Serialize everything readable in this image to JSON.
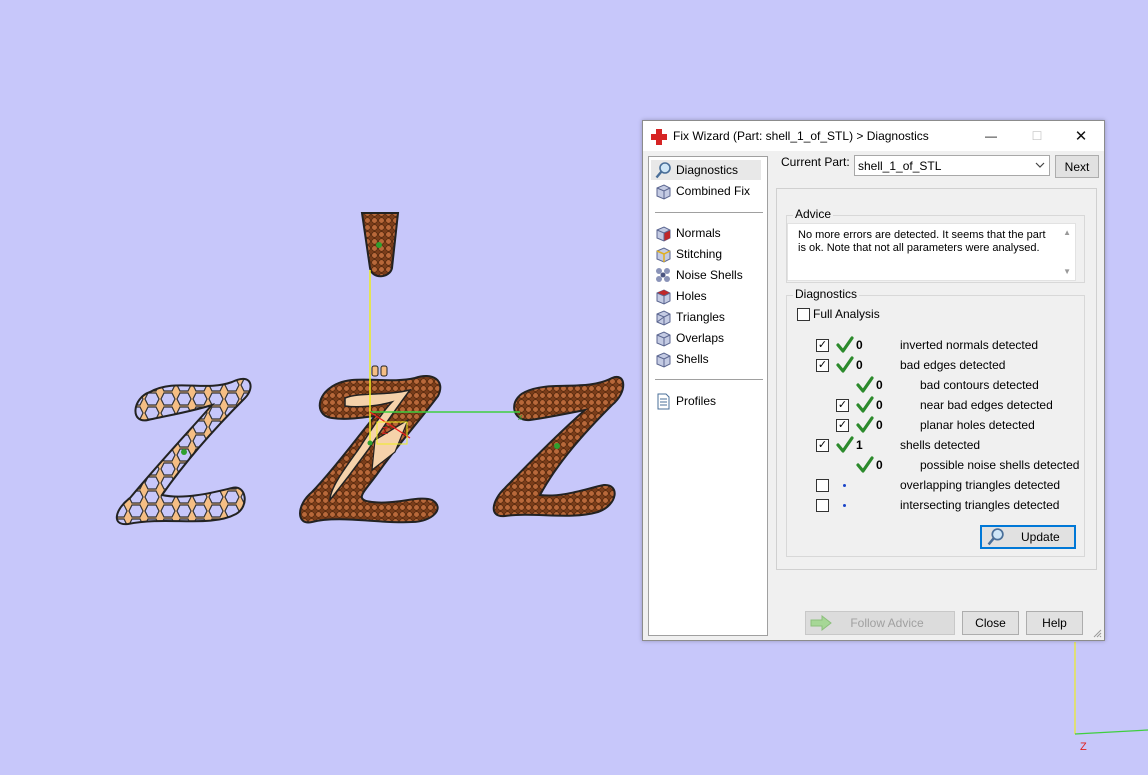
{
  "window": {
    "title": "Fix Wizard (Part: shell_1_of_STL) > Diagnostics",
    "minimize_glyph": "—",
    "maximize_glyph": "☐",
    "close_glyph": "✕"
  },
  "nav": {
    "items": [
      {
        "label": "Diagnostics",
        "icon": "magnifier-icon"
      },
      {
        "label": "Combined Fix",
        "icon": "cube-icon"
      },
      {
        "label": "Normals",
        "icon": "cube-red-icon"
      },
      {
        "label": "Stitching",
        "icon": "cube-edge-icon"
      },
      {
        "label": "Noise Shells",
        "icon": "noise-shells-icon"
      },
      {
        "label": "Holes",
        "icon": "cube-red-icon"
      },
      {
        "label": "Triangles",
        "icon": "triangle-cube-icon"
      },
      {
        "label": "Overlaps",
        "icon": "cube-icon"
      },
      {
        "label": "Shells",
        "icon": "cube-icon"
      },
      {
        "label": "Profiles",
        "icon": "document-icon"
      }
    ]
  },
  "current_part": {
    "label": "Current Part:",
    "value": "shell_1_of_STL",
    "next_label": "Next"
  },
  "advice": {
    "title": "Advice",
    "text": "No more errors are detected. It seems that the part is ok. Note that not all parameters were analysed."
  },
  "diagnostics": {
    "title": "Diagnostics",
    "full_analysis_label": "Full Analysis",
    "full_analysis_checked": false,
    "rows": [
      {
        "checkbox": true,
        "checked": true,
        "status": "ok",
        "count": "0",
        "label": "inverted normals detected",
        "indent": 0
      },
      {
        "checkbox": true,
        "checked": true,
        "status": "ok",
        "count": "0",
        "label": "bad edges detected",
        "indent": 0
      },
      {
        "checkbox": false,
        "checked": false,
        "status": "ok",
        "count": "0",
        "label": "bad contours detected",
        "indent": 1
      },
      {
        "checkbox": true,
        "checked": true,
        "status": "ok",
        "count": "0",
        "label": "near bad edges detected",
        "indent": 1
      },
      {
        "checkbox": true,
        "checked": true,
        "status": "ok",
        "count": "0",
        "label": "planar holes detected",
        "indent": 1
      },
      {
        "checkbox": true,
        "checked": true,
        "status": "ok",
        "count": "1",
        "label": "shells detected",
        "indent": 0
      },
      {
        "checkbox": false,
        "checked": false,
        "status": "ok",
        "count": "0",
        "label": "possible noise shells detected",
        "indent": 1
      },
      {
        "checkbox": true,
        "checked": false,
        "status": "dot",
        "count": "",
        "label": "overlapping triangles detected",
        "indent": 0
      },
      {
        "checkbox": true,
        "checked": false,
        "status": "dot",
        "count": "",
        "label": "intersecting triangles detected",
        "indent": 0
      }
    ],
    "update_label": "Update"
  },
  "footer": {
    "follow_advice_label": "Follow Advice",
    "close_label": "Close",
    "help_label": "Help"
  },
  "viewport": {
    "background_color": "#c7c7fa",
    "axis_label": "Z",
    "small_axis_label": "Z",
    "part_fill_color": "#f5be84",
    "part_texture_color": "#a0582c",
    "check_color": "#2c8a2c"
  }
}
